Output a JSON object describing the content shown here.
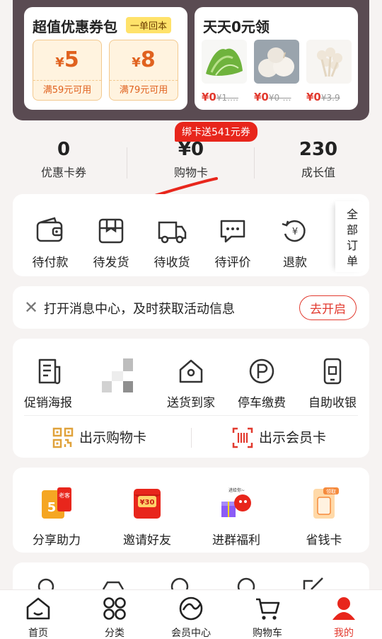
{
  "coupon_pack": {
    "title": "超值优惠券包",
    "tag": "一单回本",
    "tickets": [
      {
        "currency": "¥",
        "amount": "5",
        "condition": "满59元可用"
      },
      {
        "currency": "¥",
        "amount": "8",
        "condition": "满79元可用"
      }
    ]
  },
  "free_section": {
    "title": "天天0元领",
    "items": [
      {
        "image": "lettuce",
        "price": "¥0",
        "original": "¥1.…"
      },
      {
        "image": "garlic",
        "price": "¥0",
        "original": "¥0-…"
      },
      {
        "image": "mushroom",
        "price": "¥0",
        "original": "¥3.9"
      }
    ]
  },
  "stats": {
    "badge": "绑卡送541元券",
    "items": [
      {
        "value": "0",
        "label": "优惠卡券"
      },
      {
        "value": "¥0",
        "label": "购物卡"
      },
      {
        "value": "230",
        "label": "成长值"
      }
    ]
  },
  "orders": {
    "items": [
      {
        "label": "待付款",
        "icon": "wallet-icon"
      },
      {
        "label": "待发货",
        "icon": "package-icon"
      },
      {
        "label": "待收货",
        "icon": "truck-icon"
      },
      {
        "label": "待评价",
        "icon": "comment-icon"
      },
      {
        "label": "退款",
        "icon": "refund-icon"
      }
    ],
    "all_label": "全部订单"
  },
  "message_bar": {
    "text": "打开消息中心，及时获取活动信息",
    "button": "去开启"
  },
  "services": {
    "items": [
      {
        "label": "促销海报",
        "icon": "poster-icon"
      },
      {
        "label": "送货到家",
        "icon": "home-delivery-icon"
      },
      {
        "label": "停车缴费",
        "icon": "parking-icon"
      },
      {
        "label": "自助收银",
        "icon": "phone-checkout-icon"
      }
    ],
    "show_shopping_card": "出示购物卡",
    "show_member_card": "出示会员卡"
  },
  "promotions": {
    "items": [
      {
        "label": "分享助力",
        "icon": "share-help-icon",
        "art_text": "老客"
      },
      {
        "label": "邀请好友",
        "icon": "invite-envelope-icon",
        "art_text": "¥30"
      },
      {
        "label": "进群福利",
        "icon": "group-gift-icon",
        "art_text": "进给你~"
      },
      {
        "label": "省钱卡",
        "icon": "saving-card-icon",
        "art_text": "领取"
      }
    ]
  },
  "tabbar": {
    "items": [
      {
        "label": "首页",
        "icon": "home-icon"
      },
      {
        "label": "分类",
        "icon": "category-icon"
      },
      {
        "label": "会员中心",
        "icon": "member-center-icon"
      },
      {
        "label": "购物车",
        "icon": "cart-icon"
      },
      {
        "label": "我的",
        "icon": "profile-icon"
      }
    ],
    "active_index": 4
  },
  "colors": {
    "accent": "#e23a2f",
    "coupon_orange": "#e0621f",
    "banner_bg": "#5a4b52"
  }
}
